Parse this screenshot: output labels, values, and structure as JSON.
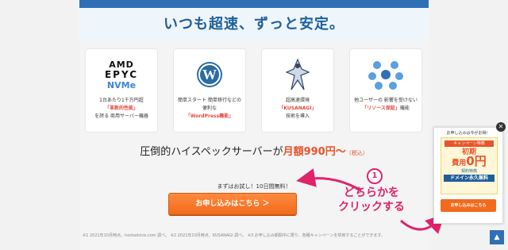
{
  "hero": {
    "title": "いつも超速、ずっと安定。"
  },
  "cards": [
    {
      "logo_lines": [
        "AMD",
        "EPYC",
        "NVMe"
      ],
      "icon": "amd-epyc-nvme-logo",
      "desc_pre": "1台あたり1千万円超",
      "desc_hl": "「革新的性能」",
      "desc_post": "を誇る 商用サーバー機器"
    },
    {
      "icon": "wordpress-icon",
      "desc_pre": "簡単スタート 簡単移行などの便利な",
      "desc_hl": "「WordPress機能」",
      "desc_post": ""
    },
    {
      "icon": "kusanagi-icon",
      "desc_pre": "超高速環境",
      "desc_hl": "「KUSANAGI」",
      "desc_post": "技術を導入"
    },
    {
      "icon": "network-people-icon",
      "desc_pre": "他ユーザーの 影響を受けない",
      "desc_hl": "「リソース保証」",
      "desc_post": "機能"
    }
  ],
  "price": {
    "pre": "圧倒的ハイスペックサーバーが",
    "amount": "月額990円〜",
    "tax": "（税込）"
  },
  "trial": "まずはお試し！10日間無料！",
  "cta": {
    "label": "お申し込みはこちら ＞"
  },
  "footnote": "※1 2021年10月時点。hostadvice.com 調べ。 ※2 2021年10月時点、KUSANAGI 調べ。 ※3 お申し込み期間中に限り、各種キャンペーンを併用することができます。",
  "annotation": {
    "number": "1",
    "text_line1": "どちらかを",
    "text_line2": "クリックする"
  },
  "widget": {
    "header": "お申し込みは今がお得！",
    "ribbon": "キャンペーン特典",
    "big1": "初期",
    "big2": "費用",
    "zero": "0円",
    "sub": "契約特典",
    "domain": "ドメイン永久無料",
    "button": "お申し込みはこちら"
  },
  "colors": {
    "accent": "#e8542b",
    "brand": "#1f5f9a",
    "annotation": "#e0246b"
  }
}
